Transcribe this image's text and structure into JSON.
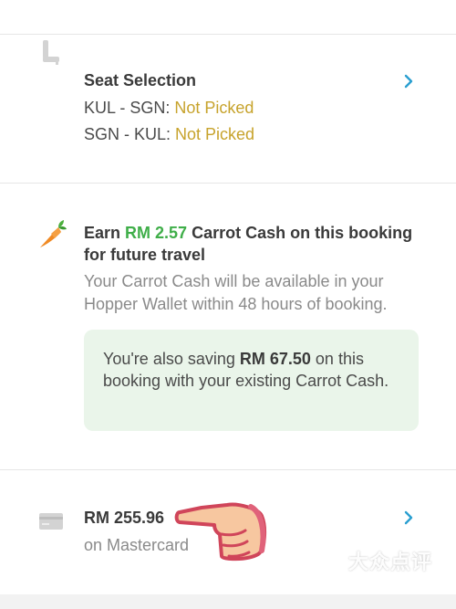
{
  "seat_selection": {
    "title": "Seat Selection",
    "routes": [
      {
        "label": "KUL - SGN: ",
        "status": "Not Picked"
      },
      {
        "label": "SGN - KUL: ",
        "status": "Not Picked"
      }
    ],
    "icon": "seat-icon",
    "chevron_icon": "chevron-right-icon"
  },
  "carrot_cash": {
    "earn_prefix": "Earn ",
    "earn_amount": "RM 2.57",
    "earn_suffix": " Carrot Cash on this booking for future travel",
    "availability_text": "Your Carrot Cash will be available in your Hopper Wallet within 48 hours of booking.",
    "savings_prefix": "You're also saving ",
    "savings_amount": "RM 67.50",
    "savings_suffix": " on this booking with your existing Carrot Cash.",
    "icon": "carrot-icon"
  },
  "payment": {
    "price": "RM 255.96",
    "method": "on Mastercard",
    "icon": "credit-card-icon",
    "chevron_icon": "chevron-right-icon"
  },
  "watermark": {
    "text": "大众点评",
    "icon": "dianping-logo-icon"
  },
  "colors": {
    "accent": "#2a9fd0",
    "status_warning": "#c7a32c",
    "carrot_green": "#3fae49",
    "savings_bg": "#eaf5ea"
  }
}
